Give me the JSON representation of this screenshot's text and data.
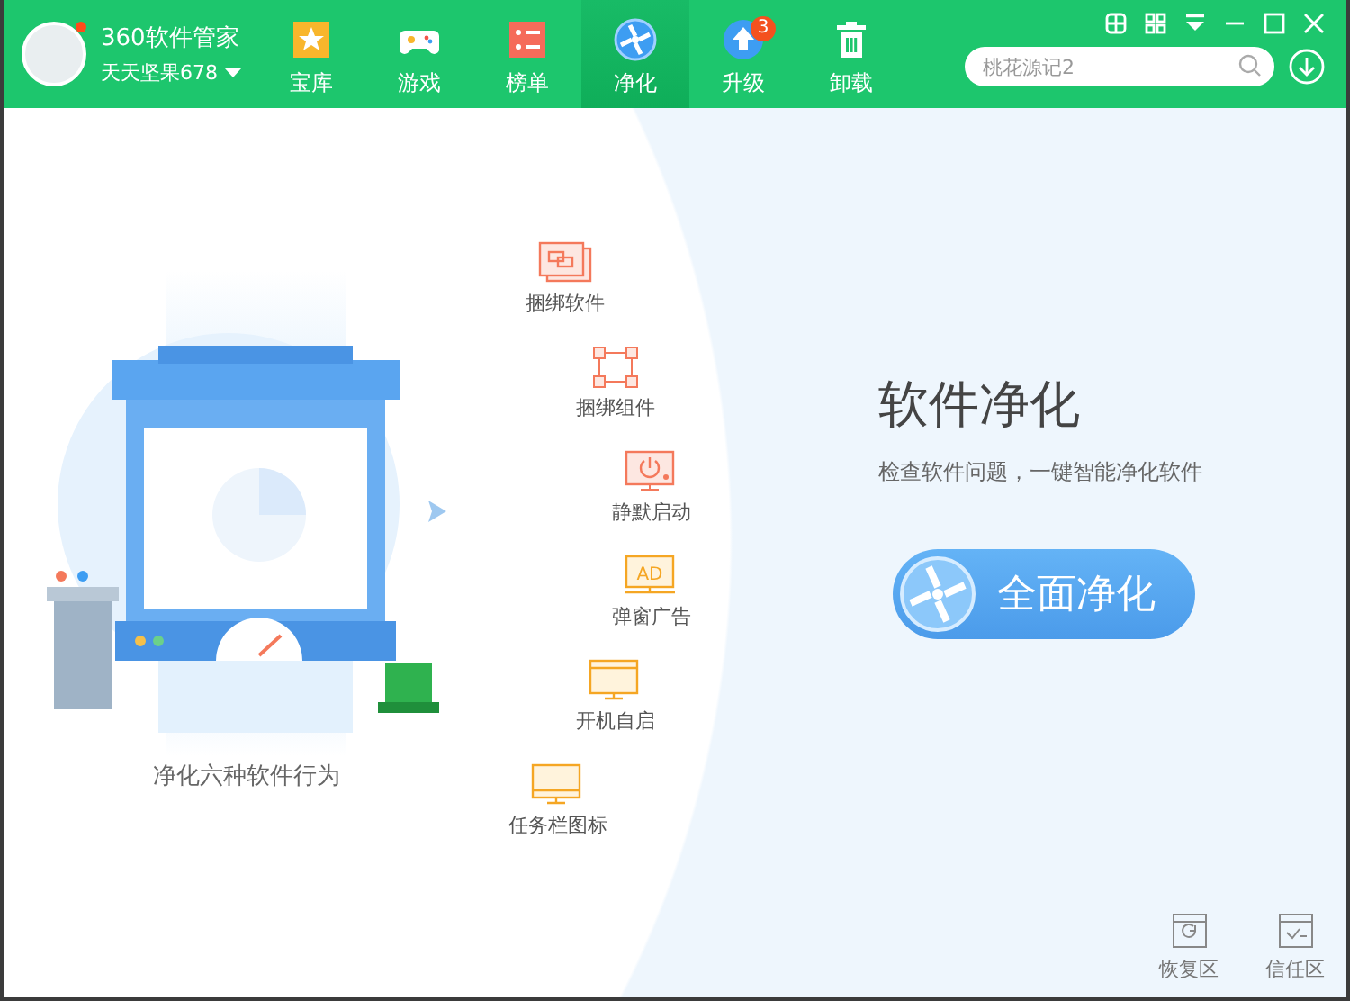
{
  "app": {
    "title": "360软件管家",
    "user": "天天坚果678"
  },
  "nav_tabs": [
    {
      "label": "宝库",
      "selected": false
    },
    {
      "label": "游戏",
      "selected": false
    },
    {
      "label": "榜单",
      "selected": false
    },
    {
      "label": "净化",
      "selected": true
    },
    {
      "label": "升级",
      "selected": false,
      "badge": "3"
    },
    {
      "label": "卸载",
      "selected": false
    }
  ],
  "search": {
    "placeholder": "桃花源记2"
  },
  "main": {
    "title": "软件净化",
    "subtitle": "检查软件问题，一键智能净化软件",
    "button": "全面净化",
    "caption": "净化六种软件行为",
    "behaviors": [
      {
        "label": "捆绑软件"
      },
      {
        "label": "捆绑组件"
      },
      {
        "label": "静默启动"
      },
      {
        "label": "弹窗广告",
        "icon_text": "AD"
      },
      {
        "label": "开机自启"
      },
      {
        "label": "任务栏图标"
      }
    ],
    "bottom_buttons": [
      "恢复区",
      "信任区"
    ]
  }
}
